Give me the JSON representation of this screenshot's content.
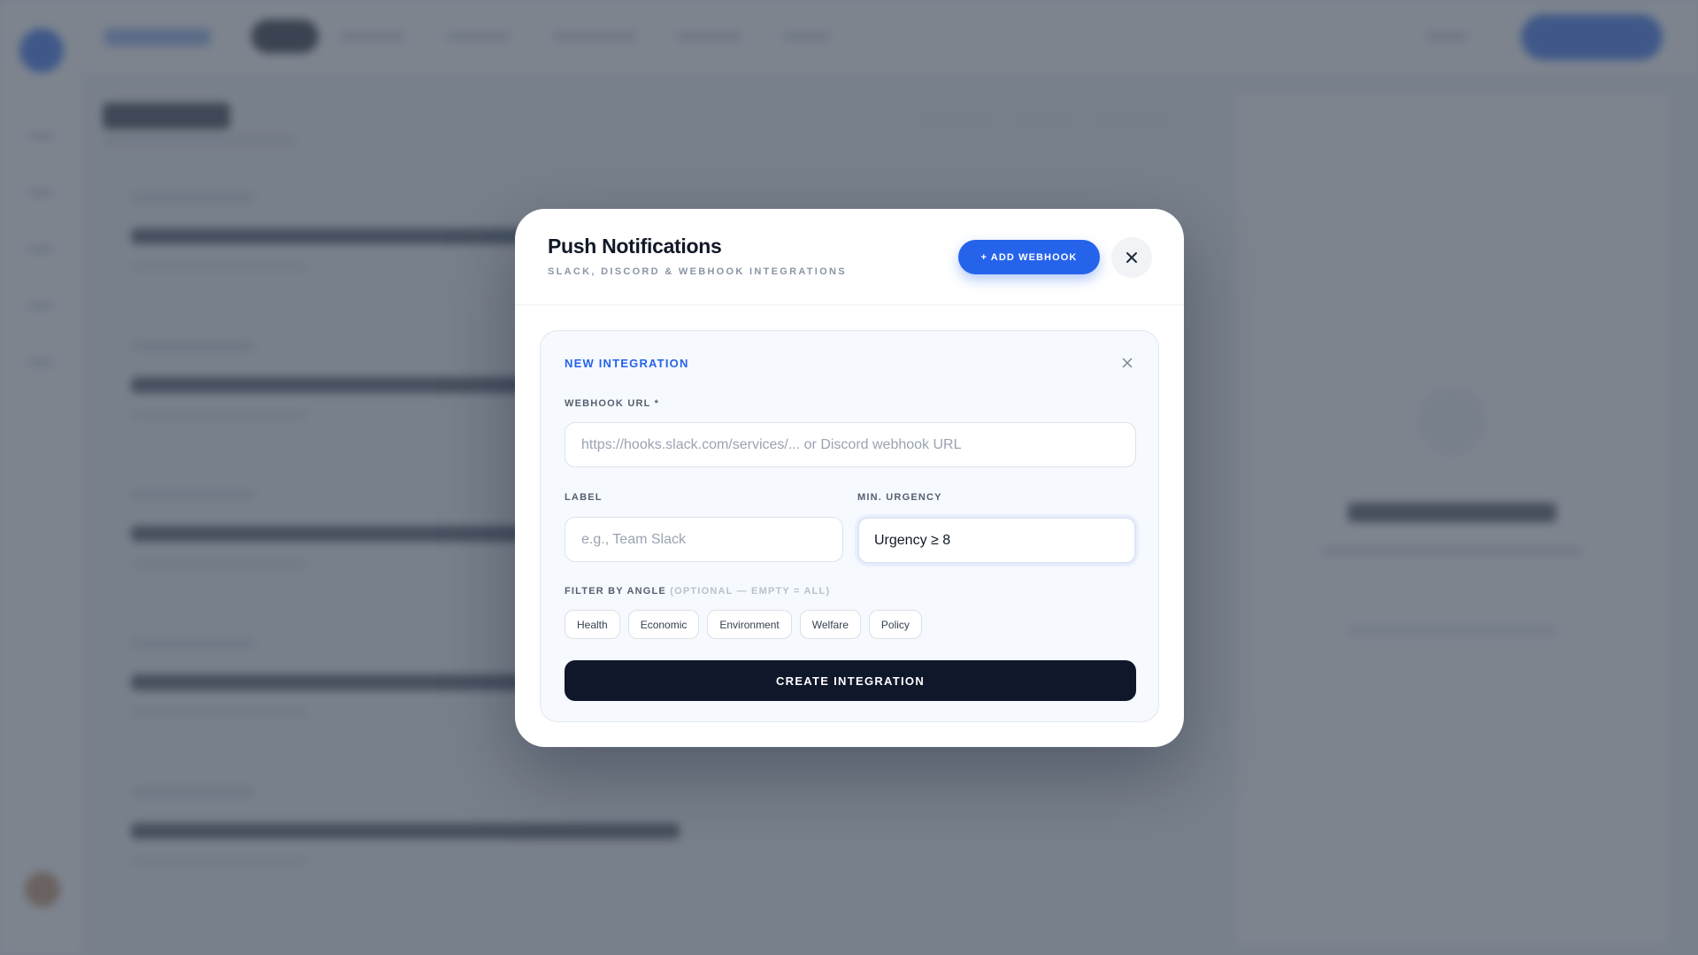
{
  "modal": {
    "title": "Push Notifications",
    "subtitle": "SLACK, DISCORD & WEBHOOK INTEGRATIONS",
    "add_webhook_label": "+ ADD WEBHOOK",
    "close_icon": "close-icon"
  },
  "form": {
    "title": "NEW INTEGRATION",
    "close_icon": "close-icon",
    "webhook_url": {
      "label": "WEBHOOK URL *",
      "value": "",
      "placeholder": "https://hooks.slack.com/services/... or Discord webhook URL"
    },
    "label_field": {
      "label": "LABEL",
      "value": "",
      "placeholder": "e.g., Team Slack"
    },
    "min_urgency": {
      "label": "MIN. URGENCY",
      "selected": "Urgency ≥ 8"
    },
    "filter": {
      "label": "FILTER BY ANGLE",
      "hint": "(OPTIONAL — EMPTY = ALL)",
      "options": [
        "Health",
        "Economic",
        "Environment",
        "Welfare",
        "Policy"
      ]
    },
    "submit_label": "CREATE INTEGRATION"
  },
  "colors": {
    "accent": "#2563eb",
    "dark": "#0f172a",
    "overlay": "rgba(75,85,99,0.72)"
  }
}
